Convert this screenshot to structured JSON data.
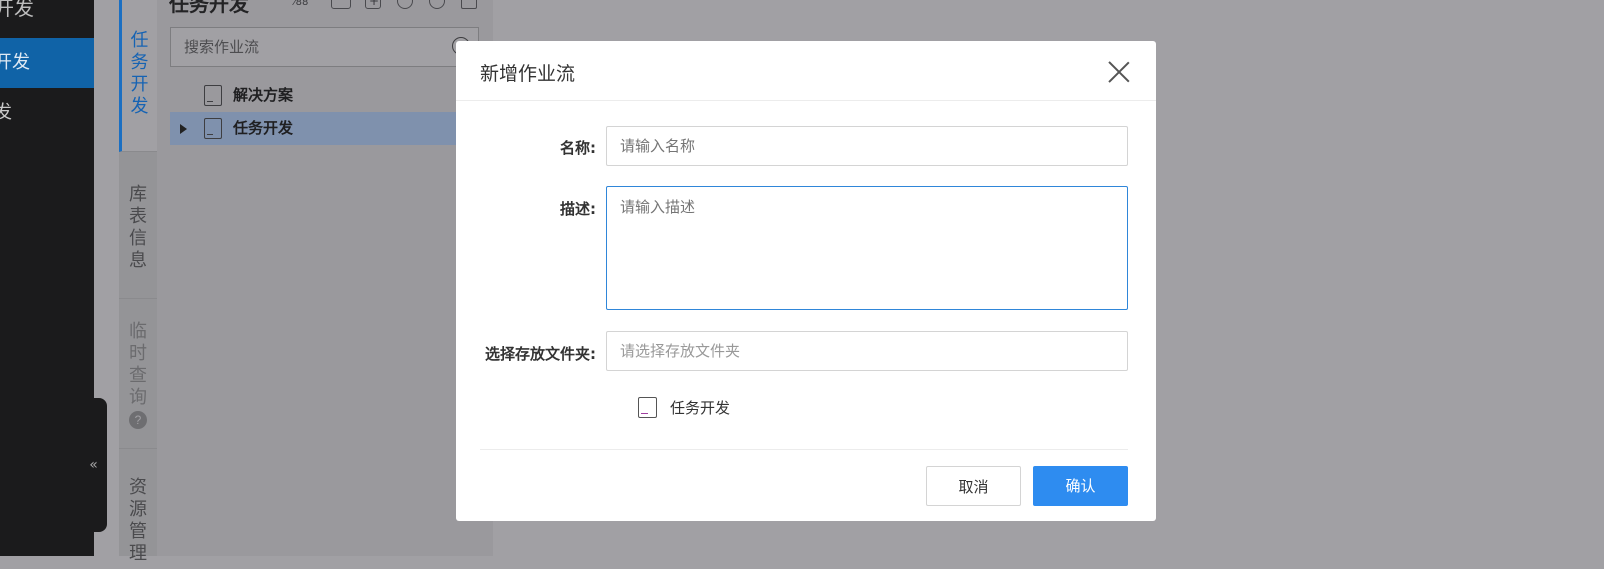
{
  "sidebar": {
    "items": [
      {
        "label": "开发"
      },
      {
        "label": "开发"
      },
      {
        "label": "发"
      }
    ],
    "collapse_glyph": "«"
  },
  "vertical_tabs": [
    {
      "label": "任务开发",
      "active": true
    },
    {
      "label": "库表信息",
      "active": false
    },
    {
      "label": "临时查询",
      "active": false,
      "help_glyph": "?"
    },
    {
      "label": "资源管理",
      "active": false
    }
  ],
  "panel": {
    "title": "任务开发",
    "search_placeholder": "搜索作业流",
    "tree": [
      {
        "label": "解决方案",
        "selected": false,
        "expandable": false
      },
      {
        "label": "任务开发",
        "selected": true,
        "expandable": true
      }
    ]
  },
  "modal": {
    "title": "新增作业流",
    "fields": {
      "name": {
        "label": "名称:",
        "placeholder": "请输入名称",
        "value": ""
      },
      "description": {
        "label": "描述:",
        "placeholder": "请输入描述",
        "value": ""
      },
      "folder": {
        "label": "选择存放文件夹:",
        "placeholder": "请选择存放文件夹",
        "value": ""
      }
    },
    "folder_option": "任务开发",
    "cancel_label": "取消",
    "confirm_label": "确认"
  },
  "colors": {
    "accent": "#2e8cf0",
    "sidebar_active": "#1063a7",
    "overlay": "#a1a0a4"
  }
}
